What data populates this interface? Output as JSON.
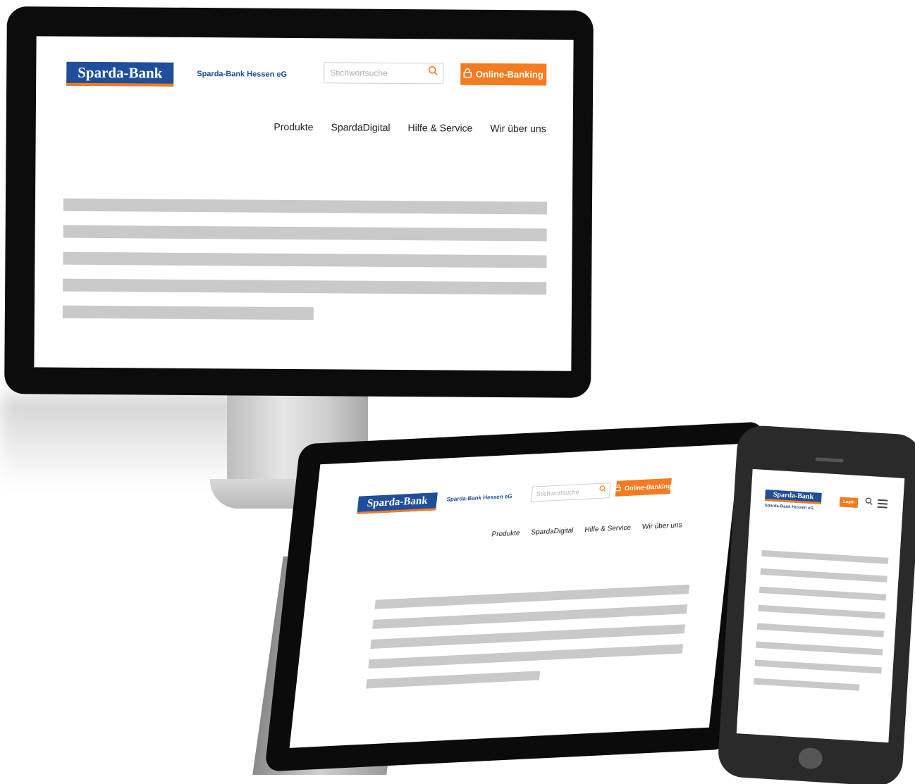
{
  "brand": {
    "logo_text": "Sparda-Bank",
    "bank_name": "Sparda-Bank Hessen eG",
    "primary_color": "#1f4e9b",
    "accent_color": "#f47b20"
  },
  "desktop": {
    "search_placeholder": "Stichwortsuche",
    "online_banking_label": "Online-Banking",
    "nav": [
      "Produkte",
      "SpardaDigital",
      "Hilfe & Service",
      "Wir über uns"
    ]
  },
  "tablet": {
    "search_placeholder": "Stichwortsuche",
    "online_banking_label": "Online-Banking",
    "nav": [
      "Produkte",
      "SpardaDigital",
      "Hilfe & Service",
      "Wir über uns"
    ]
  },
  "phone": {
    "login_label": "Login"
  },
  "icons": {
    "search": "search-icon",
    "lock": "lock-icon",
    "menu": "hamburger-menu-icon",
    "windows": "windows-logo-icon"
  }
}
